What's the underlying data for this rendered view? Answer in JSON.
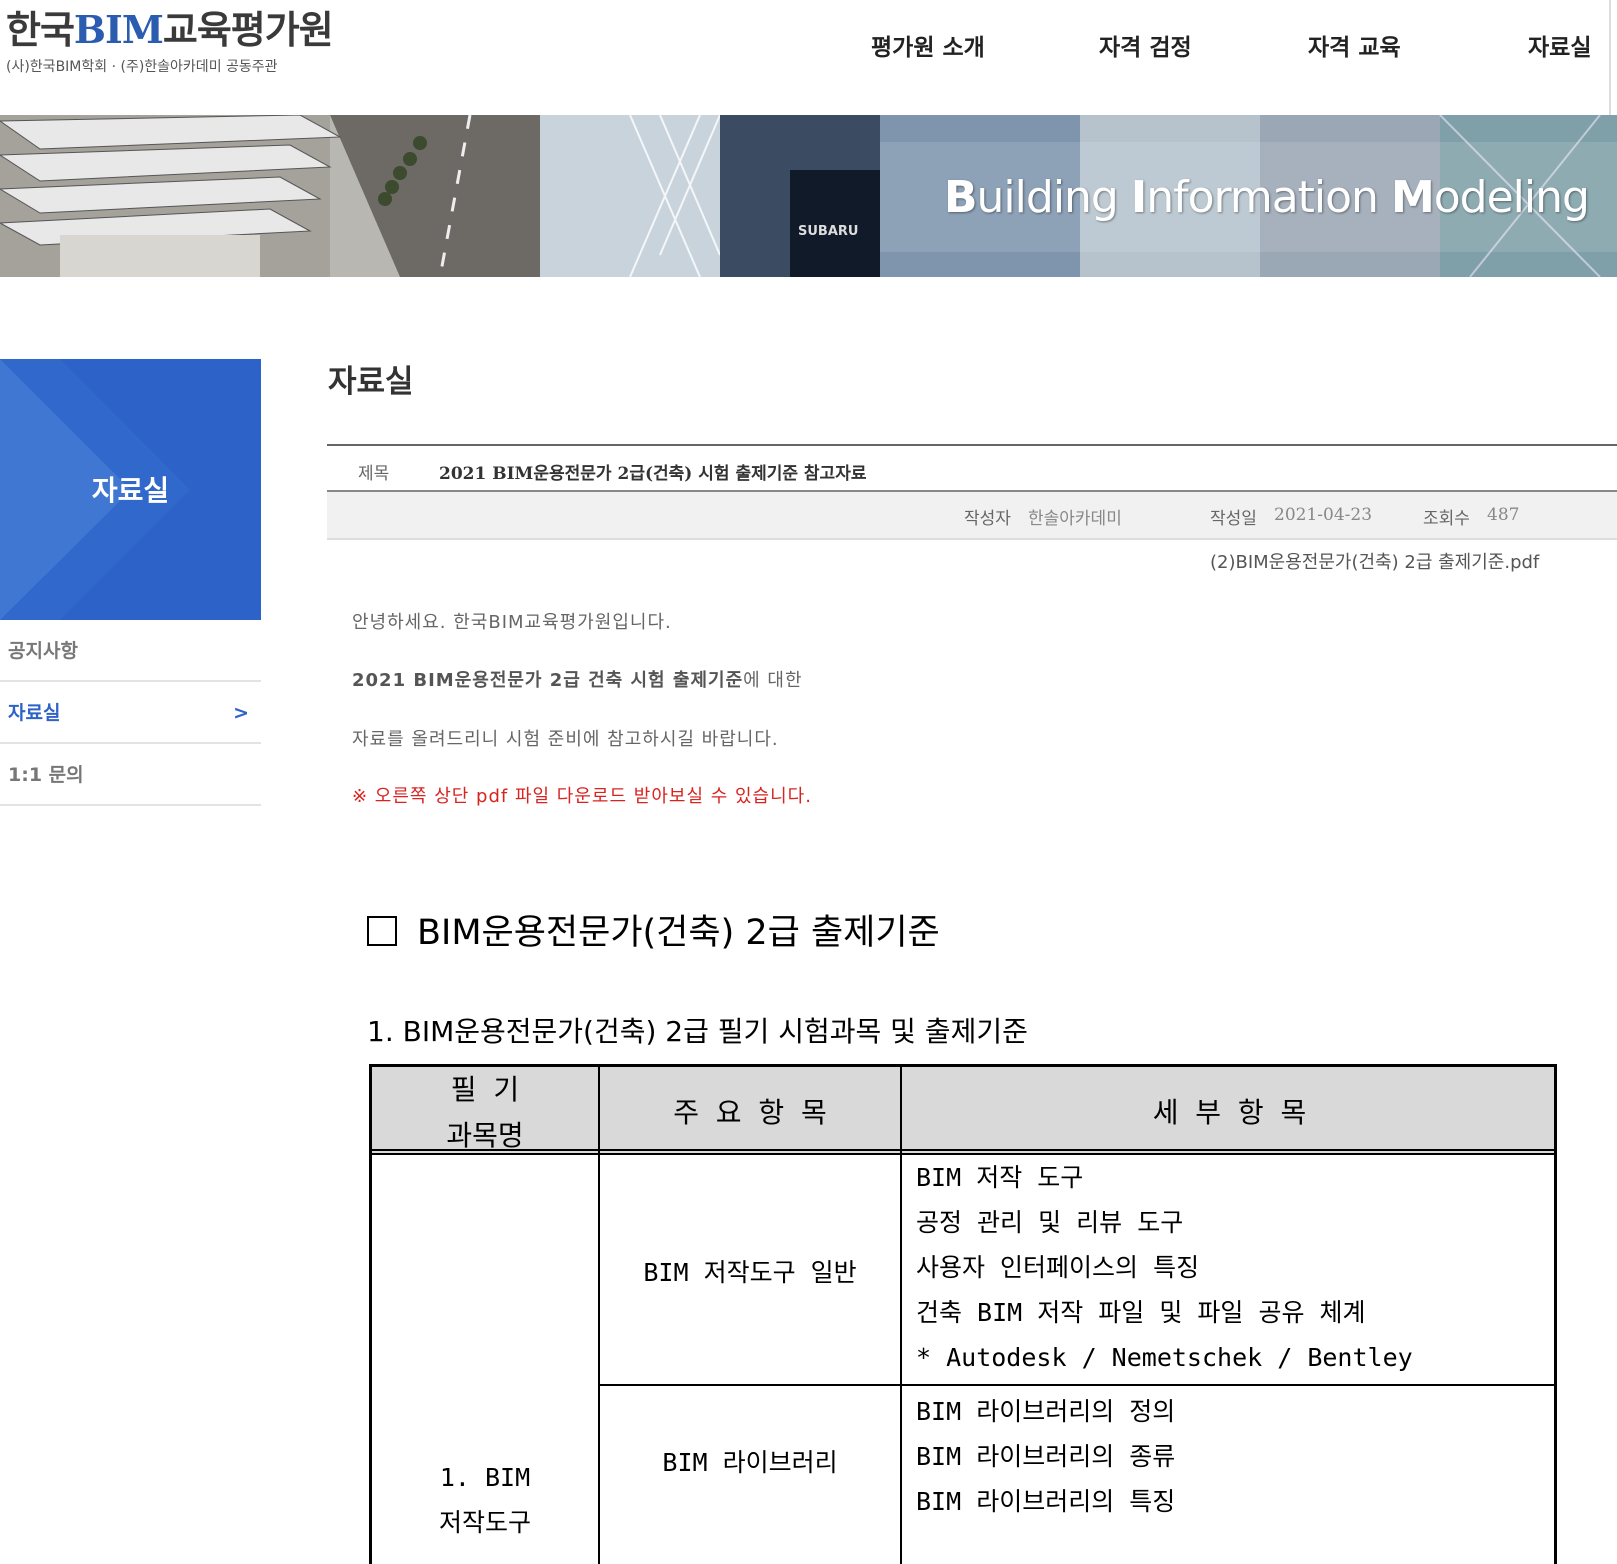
{
  "header": {
    "logo_prefix": "한국",
    "logo_highlight": "BIM",
    "logo_suffix": "교육평가원",
    "logo_sub": "(사)한국BIM학회 · (주)한솔아카데미 공동주관",
    "nav": [
      "평가원 소개",
      "자격 검정",
      "자격 교육",
      "자료실"
    ]
  },
  "banner": {
    "title_parts": [
      {
        "cap": "B",
        "rest": "uilding "
      },
      {
        "cap": "I",
        "rest": "nformation "
      },
      {
        "cap": "M",
        "rest": "odeling"
      }
    ],
    "sign_text": "SUBARU"
  },
  "sidebar": {
    "title": "자료실",
    "items": [
      {
        "label": "공지사항"
      },
      {
        "label": "자료실",
        "arrow": ">"
      },
      {
        "label": "1:1 문의"
      }
    ]
  },
  "page": {
    "title": "자료실"
  },
  "post": {
    "subject_label": "제목",
    "subject": "2021 BIM운용전문가 2급(건축) 시험 출제기준 참고자료",
    "author_label": "작성자",
    "author": "한솔아카데미",
    "date_label": "작성일",
    "date": "2021-04-23",
    "views_label": "조회수",
    "views": "487",
    "attachment": "(2)BIM운용전문가(건축) 2급 출제기준.pdf",
    "body": {
      "line1": "안녕하세요. 한국BIM교육평가원입니다.",
      "line2_bold": "2021 BIM운용전문가 2급 건축 시험 출제기준",
      "line2_rest": "에 대한",
      "line3": "자료를 올려드리니 시험 준비에 참고하시길 바랍니다.",
      "notice": "※ 오른쪽 상단 pdf 파일 다운로드 받아보실 수 있습니다."
    }
  },
  "document": {
    "heading": "BIM운용전문가(건축) 2급 출제기준",
    "subheading": "1. BIM운용전문가(건축) 2급 필기 시험과목 및 출제기준",
    "table": {
      "headers": {
        "subject_line1": "필 기",
        "subject_line2": "과목명",
        "main": "주 요 항 목",
        "detail": "세 부 항 목"
      },
      "subject_line1": "1. BIM",
      "subject_line2": "저작도구",
      "rows": [
        {
          "main": "BIM 저작도구 일반",
          "details": [
            "BIM 저작 도구",
            "공정 관리 및 리뷰 도구",
            "사용자 인터페이스의 특징",
            "건축 BIM 저작 파일 및 파일 공유 체계",
            "* Autodesk / Nemetschek / Bentley"
          ]
        },
        {
          "main": "BIM 라이브러리",
          "details": [
            "BIM 라이브러리의 정의",
            "BIM 라이브러리의 종류",
            "BIM 라이브러리의 특징"
          ]
        }
      ]
    }
  },
  "colors": {
    "accent": "#2d63c8",
    "notice": "#d8231f"
  }
}
